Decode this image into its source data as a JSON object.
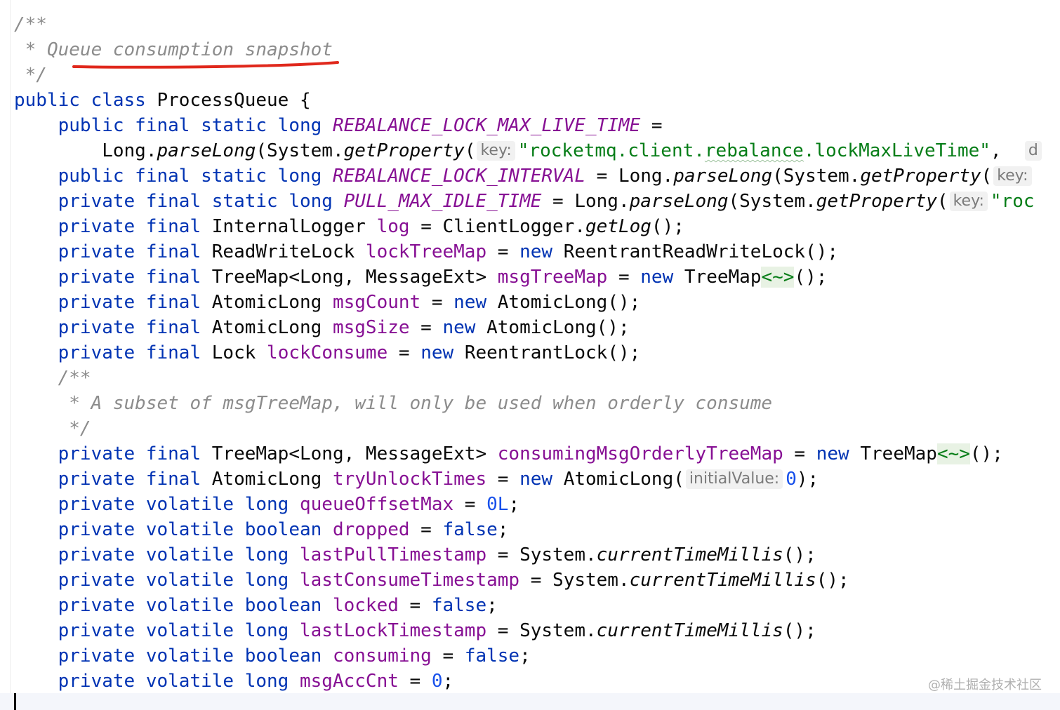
{
  "editor": {
    "lines": [
      [
        {
          "t": "/**",
          "c": "comment"
        }
      ],
      [
        {
          "t": " * Queue consumption snapshot",
          "c": "comment"
        }
      ],
      [
        {
          "t": " */",
          "c": "comment"
        }
      ],
      [
        {
          "t": "public class ",
          "c": "kw"
        },
        {
          "t": "ProcessQueue {",
          "c": "plain"
        }
      ],
      [
        {
          "t": "    public final static long ",
          "c": "kw"
        },
        {
          "t": "REBALANCE_LOCK_MAX_LIVE_TIME",
          "c": "const"
        },
        {
          "t": " =",
          "c": "plain"
        }
      ],
      [
        {
          "t": "        Long.",
          "c": "plain"
        },
        {
          "t": "parseLong",
          "c": "static-call"
        },
        {
          "t": "(System.",
          "c": "plain"
        },
        {
          "t": "getProperty",
          "c": "static-call"
        },
        {
          "t": "(",
          "c": "plain"
        },
        {
          "t": "key:",
          "c": "hint"
        },
        {
          "t": "\"rocketmq.client.",
          "c": "str"
        },
        {
          "t": "rebalance",
          "c": "str typo"
        },
        {
          "t": ".lockMaxLiveTime\"",
          "c": "str"
        },
        {
          "t": ",  ",
          "c": "plain"
        },
        {
          "t": "d",
          "c": "hint"
        }
      ],
      [
        {
          "t": "    public final static long ",
          "c": "kw"
        },
        {
          "t": "REBALANCE_LOCK_INTERVAL",
          "c": "const"
        },
        {
          "t": " = Long.",
          "c": "plain"
        },
        {
          "t": "parseLong",
          "c": "static-call"
        },
        {
          "t": "(System.",
          "c": "plain"
        },
        {
          "t": "getProperty",
          "c": "static-call"
        },
        {
          "t": "(",
          "c": "plain"
        },
        {
          "t": "key:",
          "c": "hint"
        }
      ],
      [
        {
          "t": "    private final static long ",
          "c": "kw"
        },
        {
          "t": "PULL_MAX_IDLE_TIME",
          "c": "const"
        },
        {
          "t": " = Long.",
          "c": "plain"
        },
        {
          "t": "parseLong",
          "c": "static-call"
        },
        {
          "t": "(System.",
          "c": "plain"
        },
        {
          "t": "getProperty",
          "c": "static-call"
        },
        {
          "t": "(",
          "c": "plain"
        },
        {
          "t": "key:",
          "c": "hint"
        },
        {
          "t": "\"roc",
          "c": "str"
        }
      ],
      [
        {
          "t": "    private final ",
          "c": "kw"
        },
        {
          "t": "InternalLogger ",
          "c": "plain"
        },
        {
          "t": "log",
          "c": "field"
        },
        {
          "t": " = ClientLogger.",
          "c": "plain"
        },
        {
          "t": "getLog",
          "c": "static-call"
        },
        {
          "t": "();",
          "c": "plain"
        }
      ],
      [
        {
          "t": "    private final ",
          "c": "kw"
        },
        {
          "t": "ReadWriteLock ",
          "c": "plain"
        },
        {
          "t": "lockTreeMap",
          "c": "field"
        },
        {
          "t": " = ",
          "c": "plain"
        },
        {
          "t": "new ",
          "c": "kw"
        },
        {
          "t": "ReentrantReadWriteLock();",
          "c": "plain"
        }
      ],
      [
        {
          "t": "    private final ",
          "c": "kw"
        },
        {
          "t": "TreeMap<Long, MessageExt> ",
          "c": "plain"
        },
        {
          "t": "msgTreeMap",
          "c": "field"
        },
        {
          "t": " = ",
          "c": "plain"
        },
        {
          "t": "new ",
          "c": "kw"
        },
        {
          "t": "TreeMap",
          "c": "plain"
        },
        {
          "t": "<~>",
          "c": "diamond"
        },
        {
          "t": "();",
          "c": "plain"
        }
      ],
      [
        {
          "t": "    private final ",
          "c": "kw"
        },
        {
          "t": "AtomicLong ",
          "c": "plain"
        },
        {
          "t": "msgCount",
          "c": "field"
        },
        {
          "t": " = ",
          "c": "plain"
        },
        {
          "t": "new ",
          "c": "kw"
        },
        {
          "t": "AtomicLong();",
          "c": "plain"
        }
      ],
      [
        {
          "t": "    private final ",
          "c": "kw"
        },
        {
          "t": "AtomicLong ",
          "c": "plain"
        },
        {
          "t": "msgSize",
          "c": "field"
        },
        {
          "t": " = ",
          "c": "plain"
        },
        {
          "t": "new ",
          "c": "kw"
        },
        {
          "t": "AtomicLong();",
          "c": "plain"
        }
      ],
      [
        {
          "t": "    private final ",
          "c": "kw"
        },
        {
          "t": "Lock ",
          "c": "plain"
        },
        {
          "t": "lockConsume",
          "c": "field"
        },
        {
          "t": " = ",
          "c": "plain"
        },
        {
          "t": "new ",
          "c": "kw"
        },
        {
          "t": "ReentrantLock();",
          "c": "plain"
        }
      ],
      [
        {
          "t": "    /**",
          "c": "comment"
        }
      ],
      [
        {
          "t": "     * A subset of msgTreeMap, will only be used when orderly consume",
          "c": "comment"
        }
      ],
      [
        {
          "t": "     */",
          "c": "comment"
        }
      ],
      [
        {
          "t": "    private final ",
          "c": "kw"
        },
        {
          "t": "TreeMap<Long, MessageExt> ",
          "c": "plain"
        },
        {
          "t": "consumingMsgOrderlyTreeMap",
          "c": "field"
        },
        {
          "t": " = ",
          "c": "plain"
        },
        {
          "t": "new ",
          "c": "kw"
        },
        {
          "t": "TreeMap",
          "c": "plain"
        },
        {
          "t": "<~>",
          "c": "diamond"
        },
        {
          "t": "();",
          "c": "plain"
        }
      ],
      [
        {
          "t": "    private final ",
          "c": "kw"
        },
        {
          "t": "AtomicLong ",
          "c": "plain"
        },
        {
          "t": "tryUnlockTimes",
          "c": "field"
        },
        {
          "t": " = ",
          "c": "plain"
        },
        {
          "t": "new ",
          "c": "kw"
        },
        {
          "t": "AtomicLong(",
          "c": "plain"
        },
        {
          "t": "initialValue:",
          "c": "hint"
        },
        {
          "t": "0",
          "c": "num"
        },
        {
          "t": ");",
          "c": "plain"
        }
      ],
      [
        {
          "t": "    private volatile long ",
          "c": "kw"
        },
        {
          "t": "queueOffsetMax",
          "c": "field"
        },
        {
          "t": " = ",
          "c": "plain"
        },
        {
          "t": "0L",
          "c": "num"
        },
        {
          "t": ";",
          "c": "plain"
        }
      ],
      [
        {
          "t": "    private volatile boolean ",
          "c": "kw"
        },
        {
          "t": "dropped",
          "c": "field"
        },
        {
          "t": " = ",
          "c": "plain"
        },
        {
          "t": "false",
          "c": "kw"
        },
        {
          "t": ";",
          "c": "plain"
        }
      ],
      [
        {
          "t": "    private volatile long ",
          "c": "kw"
        },
        {
          "t": "lastPullTimestamp",
          "c": "field"
        },
        {
          "t": " = System.",
          "c": "plain"
        },
        {
          "t": "currentTimeMillis",
          "c": "static-call"
        },
        {
          "t": "();",
          "c": "plain"
        }
      ],
      [
        {
          "t": "    private volatile long ",
          "c": "kw"
        },
        {
          "t": "lastConsumeTimestamp",
          "c": "field"
        },
        {
          "t": " = System.",
          "c": "plain"
        },
        {
          "t": "currentTimeMillis",
          "c": "static-call"
        },
        {
          "t": "();",
          "c": "plain"
        }
      ],
      [
        {
          "t": "    private volatile boolean ",
          "c": "kw"
        },
        {
          "t": "locked",
          "c": "field"
        },
        {
          "t": " = ",
          "c": "plain"
        },
        {
          "t": "false",
          "c": "kw"
        },
        {
          "t": ";",
          "c": "plain"
        }
      ],
      [
        {
          "t": "    private volatile long ",
          "c": "kw"
        },
        {
          "t": "lastLockTimestamp",
          "c": "field"
        },
        {
          "t": " = System.",
          "c": "plain"
        },
        {
          "t": "currentTimeMillis",
          "c": "static-call"
        },
        {
          "t": "();",
          "c": "plain"
        }
      ],
      [
        {
          "t": "    private volatile boolean ",
          "c": "kw"
        },
        {
          "t": "consuming",
          "c": "field"
        },
        {
          "t": " = ",
          "c": "plain"
        },
        {
          "t": "false",
          "c": "kw"
        },
        {
          "t": ";",
          "c": "plain"
        }
      ],
      [
        {
          "t": "    private volatile long ",
          "c": "kw"
        },
        {
          "t": "msgAccCnt",
          "c": "field"
        },
        {
          "t": " = ",
          "c": "plain"
        },
        {
          "t": "0",
          "c": "num"
        },
        {
          "t": ";",
          "c": "plain"
        }
      ]
    ]
  },
  "watermark": "@稀土掘金技术社区",
  "colors": {
    "keyword": "#0033b3",
    "field": "#871094",
    "comment": "#8c8c8c",
    "string": "#067d17",
    "number": "#1750eb",
    "annotation_underline": "#e0281c"
  }
}
